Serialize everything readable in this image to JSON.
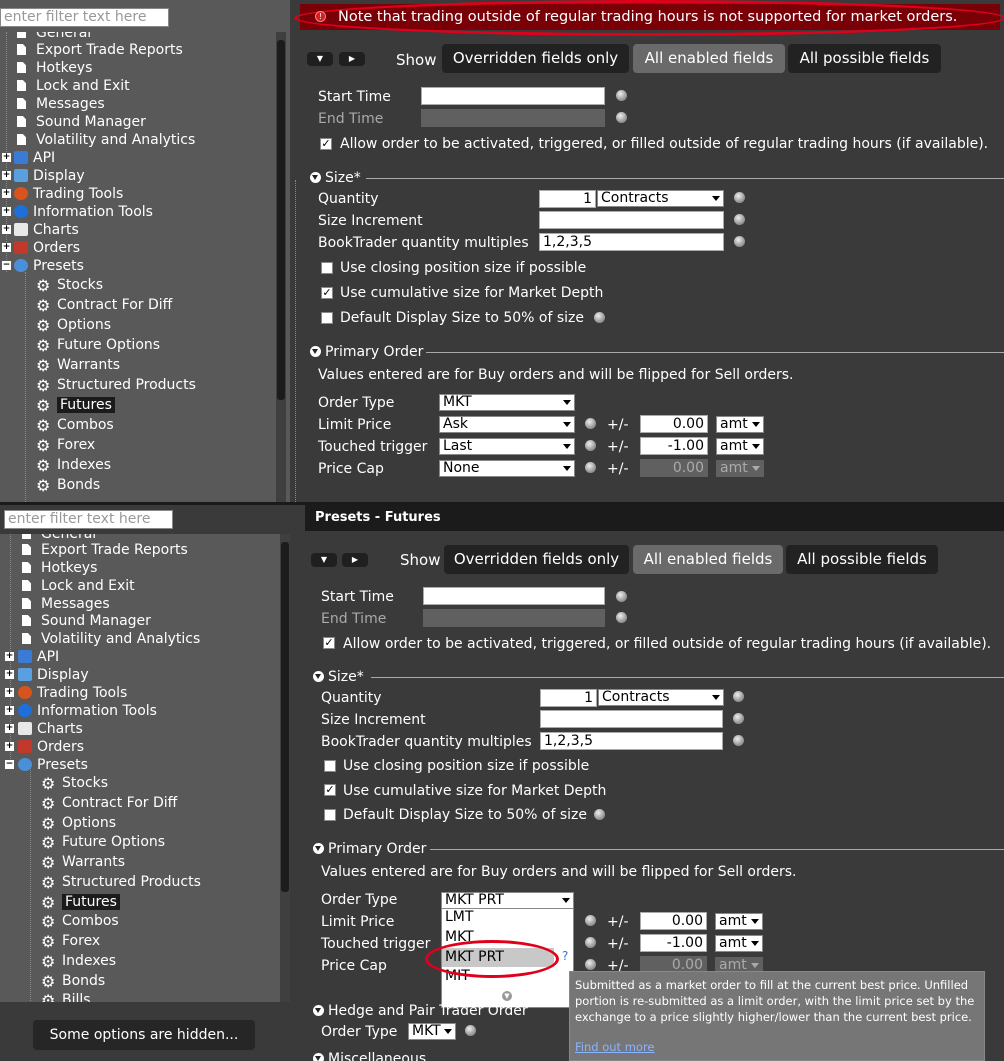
{
  "top": {
    "filter_placeholder": "enter filter text here",
    "notice": "Note that trading outside of regular trading hours is not supported for market orders.",
    "tree": {
      "general": "General",
      "export_trade_reports": "Export Trade Reports",
      "hotkeys": "Hotkeys",
      "lock_and_exit": "Lock and Exit",
      "messages": "Messages",
      "sound_manager": "Sound Manager",
      "volatility": "Volatility and Analytics",
      "api": "API",
      "display": "Display",
      "trading_tools": "Trading Tools",
      "information_tools": "Information Tools",
      "charts": "Charts",
      "orders": "Orders",
      "presets": "Presets",
      "stocks": "Stocks",
      "cfd": "Contract For Diff",
      "options": "Options",
      "future_options": "Future Options",
      "warrants": "Warrants",
      "structured": "Structured Products",
      "futures": "Futures",
      "combos": "Combos",
      "forex": "Forex",
      "indexes": "Indexes",
      "bonds": "Bonds"
    },
    "show_label": "Show",
    "btn_overridden": "Overridden fields only",
    "btn_enabled": "All enabled fields",
    "btn_possible": "All possible fields",
    "start_time": "Start Time",
    "end_time": "End Time",
    "allow_outside": "Allow order to be activated, triggered, or filled outside of regular trading hours (if available).",
    "size_section": "Size*",
    "quantity": "Quantity",
    "quantity_value": "1",
    "quantity_unit": "Contracts",
    "size_increment": "Size Increment",
    "booktrader": "BookTrader quantity multiples",
    "booktrader_value": "1,2,3,5",
    "closing": "Use closing position size if possible",
    "cumulative": "Use cumulative size for Market Depth",
    "display_size": "Default Display Size to 50% of size",
    "primary_section": "Primary Order",
    "primary_note": "Values entered are for Buy orders and will be flipped for Sell orders.",
    "order_type": "Order Type",
    "order_type_value": "MKT",
    "limit_price": "Limit Price",
    "limit_price_value": "Ask",
    "touched": "Touched trigger",
    "touched_value": "Last",
    "price_cap": "Price Cap",
    "price_cap_value": "None",
    "pm": "+/-",
    "off1": "0.00",
    "off2": "-1.00",
    "off3": "0.00",
    "amt": "amt"
  },
  "bottom": {
    "filter_placeholder": "enter filter text here",
    "header": "Presets - Futures",
    "tree": {
      "general": "General",
      "export_trade_reports": "Export Trade Reports",
      "hotkeys": "Hotkeys",
      "lock_and_exit": "Lock and Exit",
      "messages": "Messages",
      "sound_manager": "Sound Manager",
      "volatility": "Volatility and Analytics",
      "api": "API",
      "display": "Display",
      "trading_tools": "Trading Tools",
      "information_tools": "Information Tools",
      "charts": "Charts",
      "orders": "Orders",
      "presets": "Presets",
      "stocks": "Stocks",
      "cfd": "Contract For Diff",
      "options": "Options",
      "future_options": "Future Options",
      "warrants": "Warrants",
      "structured": "Structured Products",
      "futures": "Futures",
      "combos": "Combos",
      "forex": "Forex",
      "indexes": "Indexes",
      "bonds": "Bonds",
      "bills": "Bills"
    },
    "hidden_btn": "Some options are hidden...",
    "order_type_value": "MKT PRT",
    "dropdown": [
      "LMT",
      "MKT",
      "MKT PRT",
      "MIT"
    ],
    "hedge_section": "Hedge and Pair Trader Order",
    "hedge_order_type": "Order Type",
    "hedge_value": "MKT",
    "misc_section": "Miscellaneous",
    "tooltip_text": "Submitted as a market order to fill at the current best price. Unfilled portion is re-submitted as a limit order, with the limit price set by the exchange to a price slightly higher/lower than the current best price.",
    "tooltip_link": "Find out more",
    "help_mark": "?"
  },
  "colors": {
    "highlight_red": "#e0001b",
    "notice_bg": "#7a0008",
    "panel_bg": "#3a3a3a",
    "tree_bg": "#595959"
  }
}
